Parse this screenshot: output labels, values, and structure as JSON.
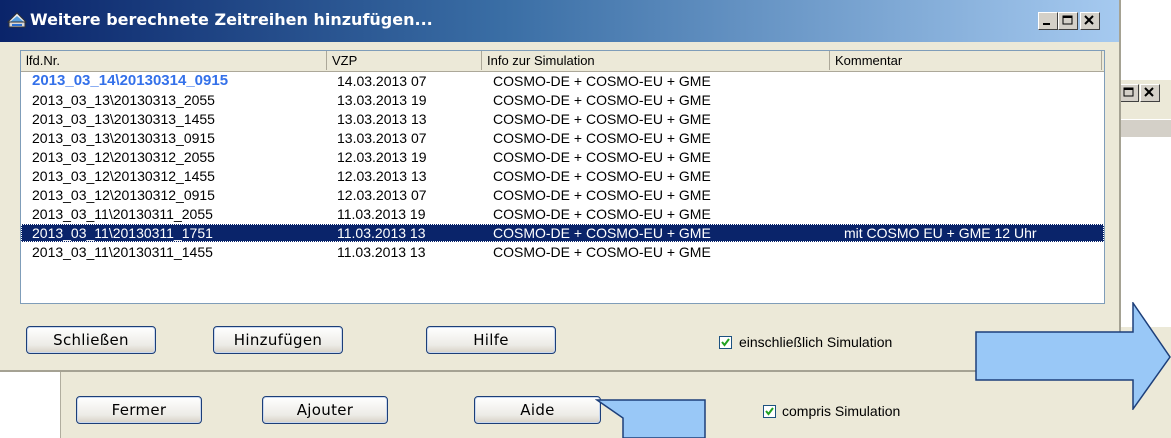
{
  "background_window": {
    "buttons": {
      "close": "Fermer",
      "add": "Ajouter",
      "help": "Aide"
    },
    "checkbox": {
      "label": "compris Simulation",
      "checked": true
    }
  },
  "window": {
    "title": "Weitere berechnete Zeitreihen hinzufügen...",
    "columns": [
      "lfd.Nr.",
      "VZP",
      "Info zur Simulation",
      "Kommentar"
    ],
    "rows": [
      {
        "id": "2013_03_14\\20130314_0915",
        "vzp": "14.03.2013 07",
        "info": "COSMO-DE + COSMO-EU + GME",
        "comment": ""
      },
      {
        "id": "2013_03_13\\20130313_2055",
        "vzp": "13.03.2013 19",
        "info": "COSMO-DE + COSMO-EU + GME",
        "comment": ""
      },
      {
        "id": "2013_03_13\\20130313_1455",
        "vzp": "13.03.2013 13",
        "info": "COSMO-DE + COSMO-EU + GME",
        "comment": ""
      },
      {
        "id": "2013_03_13\\20130313_0915",
        "vzp": "13.03.2013 07",
        "info": "COSMO-DE + COSMO-EU + GME",
        "comment": ""
      },
      {
        "id": "2013_03_12\\20130312_2055",
        "vzp": "12.03.2013 19",
        "info": "COSMO-DE + COSMO-EU + GME",
        "comment": ""
      },
      {
        "id": "2013_03_12\\20130312_1455",
        "vzp": "12.03.2013 13",
        "info": "COSMO-DE + COSMO-EU + GME",
        "comment": ""
      },
      {
        "id": "2013_03_12\\20130312_0915",
        "vzp": "12.03.2013 07",
        "info": "COSMO-DE + COSMO-EU + GME",
        "comment": ""
      },
      {
        "id": "2013_03_11\\20130311_2055",
        "vzp": "11.03.2013 19",
        "info": "COSMO-DE + COSMO-EU + GME",
        "comment": ""
      },
      {
        "id": "2013_03_11\\20130311_1751",
        "vzp": "11.03.2013 13",
        "info": "COSMO-DE + COSMO-EU + GME",
        "comment": "mit COSMO EU + GME 12 Uhr"
      },
      {
        "id": "2013_03_11\\20130311_1455",
        "vzp": "11.03.2013 13",
        "info": "COSMO-DE + COSMO-EU + GME",
        "comment": ""
      }
    ],
    "selected_row": 8,
    "highlighted_row": 0,
    "buttons": {
      "close": "Schließen",
      "add": "Hinzufügen",
      "help": "Hilfe"
    },
    "checkbox": {
      "label": "einschließlich Simulation",
      "checked": true
    }
  },
  "colors": {
    "title_bar_start": "#0a246a",
    "title_bar_end": "#a6caf0",
    "selection": "#0a246a",
    "highlight_text": "#3471ea",
    "arrow_fill": "#99c8f7"
  },
  "icons": [
    "app-icon",
    "minimize-icon",
    "maximize-icon",
    "close-icon",
    "checkmark-icon",
    "right-arrow",
    "down-arrow"
  ]
}
